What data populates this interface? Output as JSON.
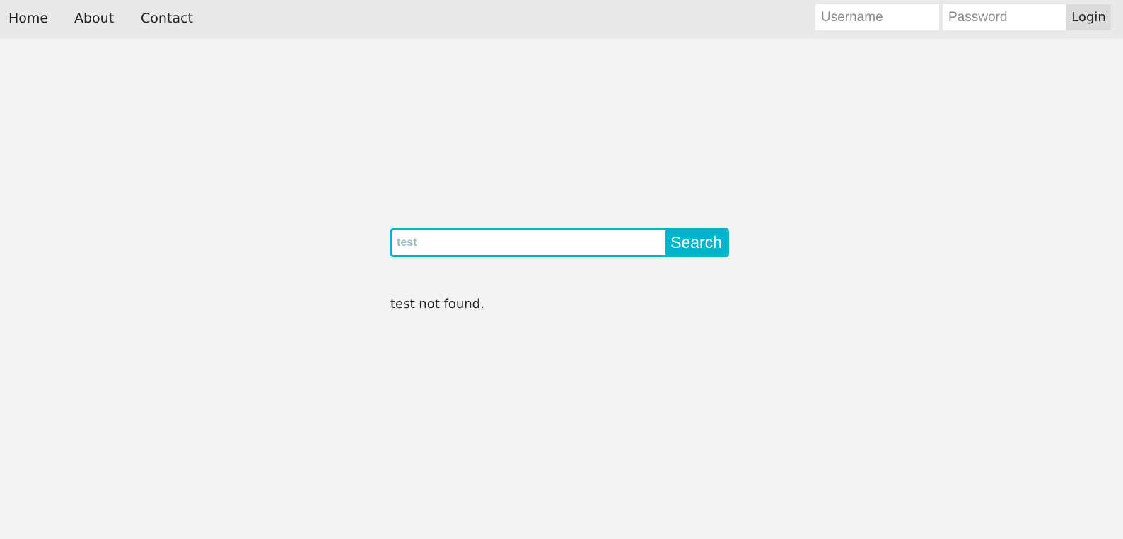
{
  "nav": {
    "home": "Home",
    "about": "About",
    "contact": "Contact"
  },
  "login": {
    "username_placeholder": "Username",
    "password_placeholder": "Password",
    "button_label": "Login"
  },
  "search": {
    "placeholder": "test",
    "button_label": "Search"
  },
  "result": {
    "message": "test not found."
  },
  "colors": {
    "accent": "#00b4cc",
    "navbar_bg": "#e9e9e9",
    "page_bg": "#f2f2f2"
  }
}
